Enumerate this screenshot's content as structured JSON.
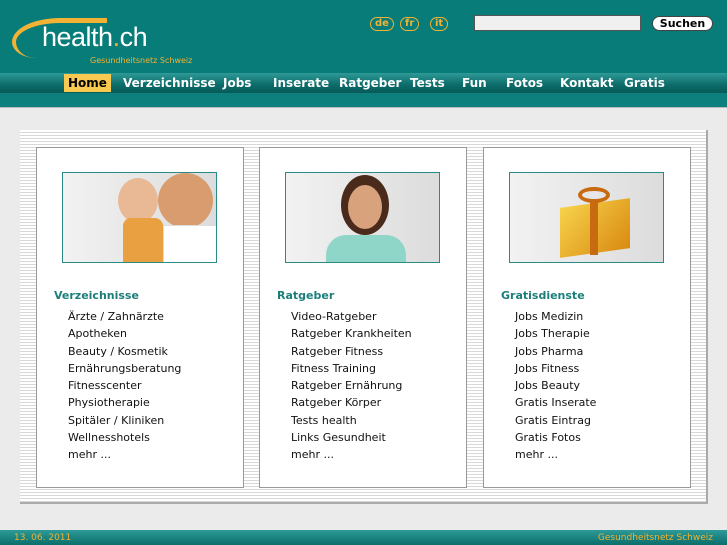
{
  "header": {
    "logo": "health.ch",
    "tagline": "Gesundheitsnetz Schweiz",
    "languages": [
      "de",
      "fr",
      "it"
    ],
    "search_value": "",
    "search_button": "Suchen"
  },
  "nav": [
    {
      "label": "Home",
      "active": true
    },
    {
      "label": "Verzeichnisse"
    },
    {
      "label": "Jobs"
    },
    {
      "label": "Inserate"
    },
    {
      "label": "Ratgeber"
    },
    {
      "label": "Tests"
    },
    {
      "label": "Fun"
    },
    {
      "label": "Fotos"
    },
    {
      "label": "Kontakt"
    },
    {
      "label": "Gratis"
    }
  ],
  "cards": [
    {
      "title": "Verzeichnisse",
      "image": "mother-baby-doctor-photo",
      "items": [
        "Ärzte / Zahnärzte",
        "Apotheken",
        "Beauty / Kosmetik",
        "Ernährungsberatung",
        "Fitnesscenter",
        "Physiotherapie",
        "Spitäler / Kliniken",
        "Wellnesshotels",
        "mehr ..."
      ]
    },
    {
      "title": "Ratgeber",
      "image": "smiling-woman-photo",
      "items": [
        "Video-Ratgeber",
        "Ratgeber Krankheiten",
        "Ratgeber Fitness",
        "Fitness Training",
        "Ratgeber Ernährung",
        "Ratgeber Körper",
        "Tests health",
        "Links Gesundheit",
        "mehr ..."
      ]
    },
    {
      "title": "Gratisdienste",
      "image": "gift-box-photo",
      "items": [
        "Jobs Medizin",
        "Jobs Therapie",
        "Jobs Pharma",
        "Jobs Fitness",
        "Jobs Beauty",
        "Gratis Inserate",
        "Gratis Eintrag",
        "Gratis Fotos",
        "mehr ..."
      ]
    }
  ],
  "footer": {
    "date": "13. 06. 2011",
    "tagline": "Gesundheitsnetz Schweiz"
  },
  "colors": {
    "brand_teal": "#077c79",
    "accent_gold": "#f2b233",
    "heading": "#1b7e7b"
  }
}
